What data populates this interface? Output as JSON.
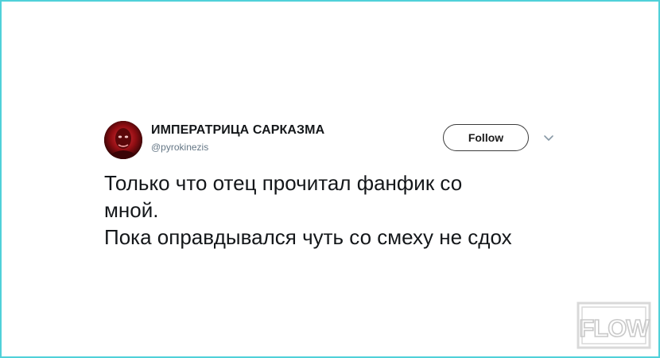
{
  "tweet": {
    "author_name": "ИМПЕРАТРИЦА САРКАЗМА",
    "author_handle": "@pyrokinezis",
    "follow_label": "Follow",
    "lines": [
      "Только что отец прочитал фанфик со",
      "мной.",
      "Пока оправдывался чуть со смеху не сдох"
    ]
  },
  "watermark": {
    "text": "FLOW"
  },
  "icons": {
    "avatar": "avatar",
    "menu": "chevron-down-icon",
    "watermark": "flow-logo"
  },
  "colors": {
    "frame": "#4fd0d9",
    "text": "#14171a",
    "handle": "#657786"
  }
}
